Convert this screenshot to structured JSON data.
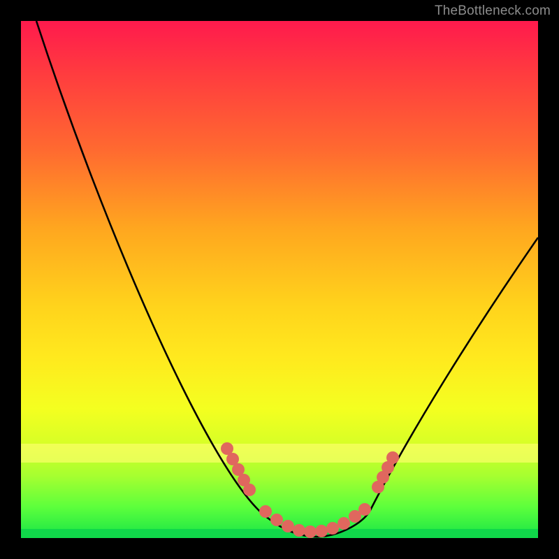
{
  "watermark": "TheBottleneck.com",
  "colors": {
    "frame_bg": "#000000",
    "curve": "#000000",
    "marker_fill": "#e0675e",
    "marker_stroke": "#e0675e",
    "gradient_top": "#ff1a4d",
    "gradient_bottom": "#17e547",
    "yellow_band": "rgba(255,255,110,0.65)",
    "green_band": "#10d84a"
  },
  "chart_data": {
    "type": "line",
    "title": "",
    "xlabel": "",
    "ylabel": "",
    "xlim": [
      0,
      100
    ],
    "ylim": [
      0,
      100
    ],
    "grid": false,
    "legend": false,
    "series": [
      {
        "name": "bottleneck-curve",
        "x": [
          3,
          8,
          13,
          18,
          23,
          28,
          33,
          38,
          42,
          46,
          49,
          52,
          55,
          58,
          61,
          64,
          67,
          70,
          73,
          76,
          80,
          84,
          88,
          92,
          96,
          100
        ],
        "y": [
          100,
          91,
          82,
          73,
          64,
          55,
          46,
          37,
          28,
          20,
          13,
          8,
          4,
          2,
          1,
          2,
          5,
          10,
          17,
          24,
          32,
          39,
          45,
          50,
          54,
          58
        ]
      }
    ],
    "markers": [
      {
        "x": 40,
        "y_band": "yellow"
      },
      {
        "x": 42,
        "y_band": "yellow"
      },
      {
        "x": 44,
        "y_band": "yellow"
      },
      {
        "x": 46,
        "y_band": "yellow"
      },
      {
        "x": 47,
        "y_band": "yellow"
      },
      {
        "x": 49,
        "y_band": "green"
      },
      {
        "x": 51,
        "y_band": "green"
      },
      {
        "x": 53,
        "y_band": "green"
      },
      {
        "x": 55,
        "y_band": "green"
      },
      {
        "x": 57,
        "y_band": "green"
      },
      {
        "x": 59,
        "y_band": "green"
      },
      {
        "x": 61,
        "y_band": "green"
      },
      {
        "x": 63,
        "y_band": "green"
      },
      {
        "x": 65,
        "y_band": "green"
      },
      {
        "x": 67,
        "y_band": "green"
      },
      {
        "x": 70,
        "y_band": "yellow"
      },
      {
        "x": 71,
        "y_band": "yellow"
      },
      {
        "x": 73,
        "y_band": "yellow"
      },
      {
        "x": 74,
        "y_band": "yellow"
      }
    ],
    "bands": {
      "yellow": {
        "y_center": 16.5,
        "y_range": [
          14.5,
          18.5
        ]
      },
      "green": {
        "y_center": 1.0,
        "y_range": [
          0,
          2
        ]
      }
    }
  }
}
